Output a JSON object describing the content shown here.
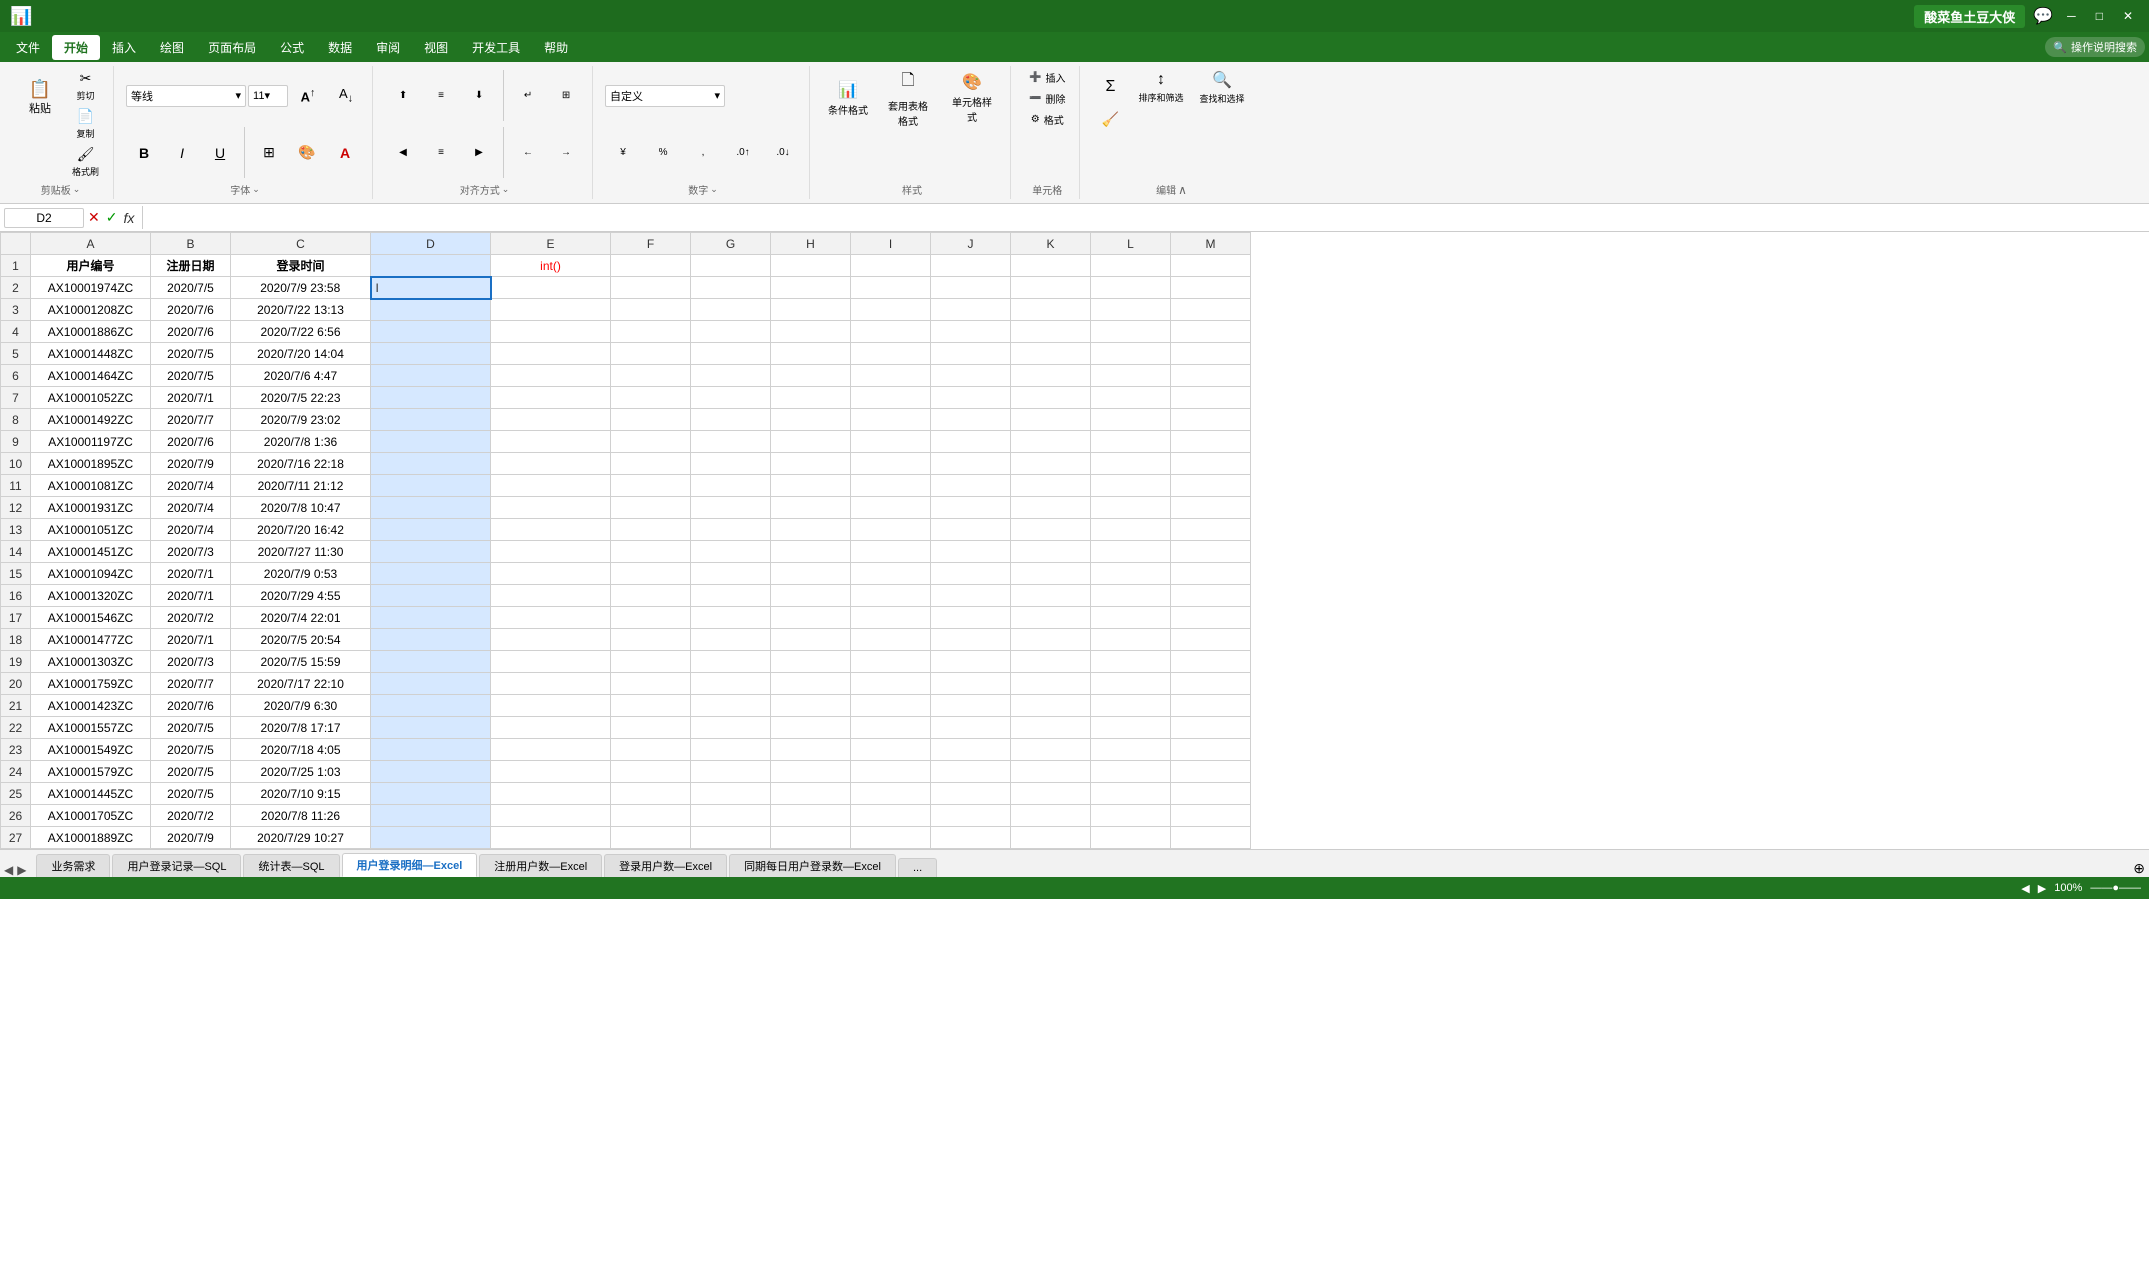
{
  "titleBar": {
    "username": "酸菜鱼土豆大侠",
    "chatIcon": "💬"
  },
  "menuBar": {
    "items": [
      "文件",
      "开始",
      "插入",
      "绘图",
      "页面布局",
      "公式",
      "数据",
      "审阅",
      "视图",
      "开发工具",
      "帮助"
    ],
    "activeItem": "开始",
    "searchPlaceholder": "操作说明搜索",
    "searchIcon": "🔍"
  },
  "ribbon": {
    "groups": {
      "clipboard": {
        "label": "剪贴板",
        "pasteBtn": "粘贴",
        "cutBtn": "✂",
        "copyBtn": "📋",
        "formatPainterBtn": "🖌"
      },
      "font": {
        "label": "字体",
        "fontName": "等线",
        "fontSize": "11",
        "boldBtn": "B",
        "italicBtn": "I",
        "underlineBtn": "U",
        "borderBtn": "⊞",
        "fillBtn": "A",
        "fontColorBtn": "A",
        "increaseSizeBtn": "A↑",
        "decreaseSizeBtn": "A↓"
      },
      "alignment": {
        "label": "对齐方式",
        "topAlignBtn": "≡",
        "midAlignBtn": "≡",
        "botAlignBtn": "≡",
        "leftAlignBtn": "≡",
        "centerAlignBtn": "≡",
        "rightAlignBtn": "≡",
        "wrapTextBtn": "↵",
        "mergeBtn": "⊞",
        "indentDecBtn": "←",
        "indentIncBtn": "→"
      },
      "number": {
        "label": "数字",
        "formatDropdown": "自定义",
        "percentBtn": "%",
        "commaBtn": ",",
        "currencyBtn": "¥",
        "decIncBtn": ".0",
        "decDecBtn": ".00"
      },
      "styles": {
        "label": "样式",
        "conditionalFormatBtn": "条件格式",
        "tableFormatBtn": "套用\n表格格式",
        "cellStyleBtn": "单元格样式"
      },
      "cells": {
        "label": "单元格",
        "insertBtn": "插入",
        "deleteBtn": "删除",
        "formatBtn": "格式"
      },
      "editing": {
        "label": "编辑",
        "sumBtn": "Σ",
        "sortBtn": "↕",
        "filterBtn": "▼",
        "findBtn": "🔍",
        "findLabel": "查找和选择",
        "clearBtn": "✕"
      }
    }
  },
  "formulaBar": {
    "cellRef": "D2",
    "cancelBtn": "✕",
    "confirmBtn": "✓",
    "formulaBtn": "fx",
    "formula": ""
  },
  "columns": {
    "rowNum": "#",
    "headers": [
      "",
      "A",
      "B",
      "C",
      "D",
      "E",
      "F",
      "G",
      "H",
      "I",
      "J",
      "K",
      "L",
      "M"
    ]
  },
  "columnHeaders": {
    "A": "用户编号",
    "B": "注册日期",
    "C": "登录时间"
  },
  "specialCell": {
    "E1": "int()"
  },
  "rows": [
    {
      "row": 2,
      "A": "AX10001974ZC",
      "B": "2020/7/5",
      "C": "2020/7/9 23:58"
    },
    {
      "row": 3,
      "A": "AX10001208ZC",
      "B": "2020/7/6",
      "C": "2020/7/22 13:13"
    },
    {
      "row": 4,
      "A": "AX10001886ZC",
      "B": "2020/7/6",
      "C": "2020/7/22 6:56"
    },
    {
      "row": 5,
      "A": "AX10001448ZC",
      "B": "2020/7/5",
      "C": "2020/7/20 14:04"
    },
    {
      "row": 6,
      "A": "AX10001464ZC",
      "B": "2020/7/5",
      "C": "2020/7/6 4:47"
    },
    {
      "row": 7,
      "A": "AX10001052ZC",
      "B": "2020/7/1",
      "C": "2020/7/5 22:23"
    },
    {
      "row": 8,
      "A": "AX10001492ZC",
      "B": "2020/7/7",
      "C": "2020/7/9 23:02"
    },
    {
      "row": 9,
      "A": "AX10001197ZC",
      "B": "2020/7/6",
      "C": "2020/7/8 1:36"
    },
    {
      "row": 10,
      "A": "AX10001895ZC",
      "B": "2020/7/9",
      "C": "2020/7/16 22:18"
    },
    {
      "row": 11,
      "A": "AX10001081ZC",
      "B": "2020/7/4",
      "C": "2020/7/11 21:12"
    },
    {
      "row": 12,
      "A": "AX10001931ZC",
      "B": "2020/7/4",
      "C": "2020/7/8 10:47"
    },
    {
      "row": 13,
      "A": "AX10001051ZC",
      "B": "2020/7/4",
      "C": "2020/7/20 16:42"
    },
    {
      "row": 14,
      "A": "AX10001451ZC",
      "B": "2020/7/3",
      "C": "2020/7/27 11:30"
    },
    {
      "row": 15,
      "A": "AX10001094ZC",
      "B": "2020/7/1",
      "C": "2020/7/9 0:53"
    },
    {
      "row": 16,
      "A": "AX10001320ZC",
      "B": "2020/7/1",
      "C": "2020/7/29 4:55"
    },
    {
      "row": 17,
      "A": "AX10001546ZC",
      "B": "2020/7/2",
      "C": "2020/7/4 22:01"
    },
    {
      "row": 18,
      "A": "AX10001477ZC",
      "B": "2020/7/1",
      "C": "2020/7/5 20:54"
    },
    {
      "row": 19,
      "A": "AX10001303ZC",
      "B": "2020/7/3",
      "C": "2020/7/5 15:59"
    },
    {
      "row": 20,
      "A": "AX10001759ZC",
      "B": "2020/7/7",
      "C": "2020/7/17 22:10"
    },
    {
      "row": 21,
      "A": "AX10001423ZC",
      "B": "2020/7/6",
      "C": "2020/7/9 6:30"
    },
    {
      "row": 22,
      "A": "AX10001557ZC",
      "B": "2020/7/5",
      "C": "2020/7/8 17:17"
    },
    {
      "row": 23,
      "A": "AX10001549ZC",
      "B": "2020/7/5",
      "C": "2020/7/18 4:05"
    },
    {
      "row": 24,
      "A": "AX10001579ZC",
      "B": "2020/7/5",
      "C": "2020/7/25 1:03"
    },
    {
      "row": 25,
      "A": "AX10001445ZC",
      "B": "2020/7/5",
      "C": "2020/7/10 9:15"
    },
    {
      "row": 26,
      "A": "AX10001705ZC",
      "B": "2020/7/2",
      "C": "2020/7/8 11:26"
    },
    {
      "row": 27,
      "A": "AX10001889ZC",
      "B": "2020/7/9",
      "C": "2020/7/29 10:27"
    }
  ],
  "sheetTabs": [
    {
      "label": "业务需求",
      "active": false
    },
    {
      "label": "用户登录记录—SQL",
      "active": false
    },
    {
      "label": "统计表—SQL",
      "active": false
    },
    {
      "label": "用户登录明细—Excel",
      "active": true
    },
    {
      "label": "注册用户数—Excel",
      "active": false
    },
    {
      "label": "登录用户数—Excel",
      "active": false
    },
    {
      "label": "同期每日用户登录数—Excel",
      "active": false
    },
    {
      "label": "...",
      "active": false
    }
  ],
  "statusBar": {
    "readyText": "",
    "zoomLevel": "100%"
  }
}
